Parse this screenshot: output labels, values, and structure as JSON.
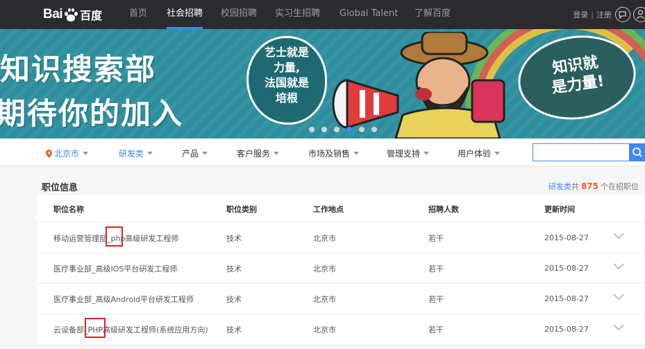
{
  "brand": {
    "logo_latin": "Bai",
    "logo_cn": "百度"
  },
  "nav": {
    "items": [
      "首页",
      "社会招聘",
      "校园招聘",
      "实习生招聘",
      "Global Talent",
      "了解百度"
    ],
    "active_index": 1
  },
  "account": {
    "login": "登录",
    "separator": "|",
    "register": "注册"
  },
  "icons": {
    "chat": "chat-bubble-icon",
    "user": "user-circle-icon"
  },
  "banner": {
    "headline_1": "知识搜索部",
    "headline_2": "期待你的加入",
    "badge_left": [
      "艺士就是",
      "力量,",
      "法国就是",
      "培根"
    ],
    "badge_right": [
      "知识就",
      "是力量!"
    ],
    "slide_count": 6,
    "active_slide": 3
  },
  "filters": {
    "location": "北京市",
    "items": [
      "研发类",
      "产品",
      "客户服务",
      "市场及销售",
      "管理支持",
      "用户体验"
    ],
    "active_index": 0,
    "search_placeholder": ""
  },
  "listing": {
    "title": "职位信息",
    "category": "研发类",
    "count_prefix": "共",
    "count": "875",
    "count_suffix": "个在招职位"
  },
  "table": {
    "headers": [
      "职位名称",
      "职位类别",
      "工作地点",
      "招聘人数",
      "更新时间"
    ],
    "rows": [
      {
        "name": "移动运营管理部_php高级研发工程师",
        "category": "技术",
        "location": "北京市",
        "headcount": "若干",
        "updated": "2015-08-27"
      },
      {
        "name": "医疗事业部_高级IOS平台研发工程师",
        "category": "技术",
        "location": "北京市",
        "headcount": "若干",
        "updated": "2015-08-27"
      },
      {
        "name": "医疗事业部_高级Android平台研发工程师",
        "category": "技术",
        "location": "北京市",
        "headcount": "若干",
        "updated": "2015-08-27"
      },
      {
        "name": "云设备部_PHP高级研发工程师(系统应用方向)",
        "category": "技术",
        "location": "北京市",
        "headcount": "若干",
        "updated": "2015-08-27"
      }
    ]
  },
  "colors": {
    "accent": "#3f88f5",
    "topbar": "#2b2b2f",
    "banner": "#2d8e9d",
    "count": "#ff5a1f",
    "highlight": "#e02020"
  }
}
